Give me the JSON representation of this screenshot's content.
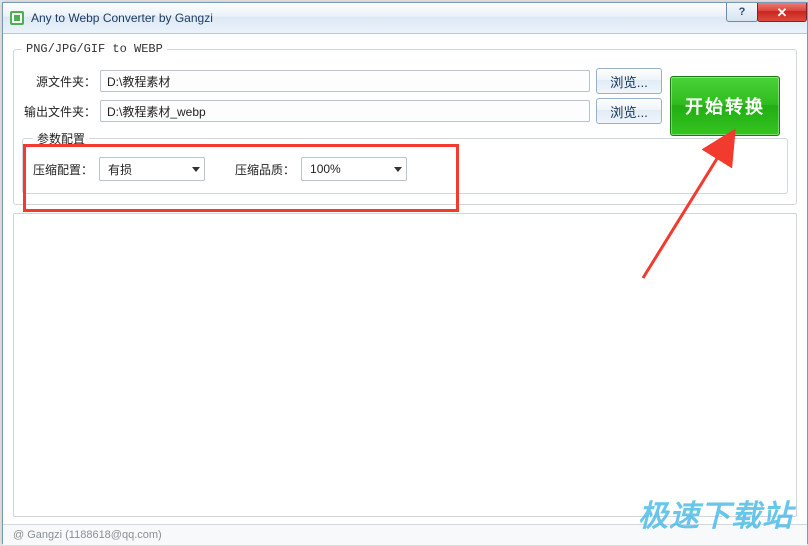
{
  "window": {
    "title": "Any to Webp Converter by Gangzi"
  },
  "group": {
    "title": "PNG/JPG/GIF to WEBP"
  },
  "fields": {
    "source_label": "源文件夹：",
    "source_value": "D:\\教程素材",
    "output_label": "输出文件夹：",
    "output_value": "D:\\教程素材_webp",
    "browse_label": "浏览..."
  },
  "params": {
    "legend": "参数配置",
    "mode_label": "压缩配置：",
    "mode_value": "有损",
    "quality_label": "压缩品质：",
    "quality_value": "100%"
  },
  "actions": {
    "convert": "开始转换"
  },
  "status": {
    "text": "@ Gangzi (1188618@qq.com)"
  },
  "watermark": "极速下载站"
}
